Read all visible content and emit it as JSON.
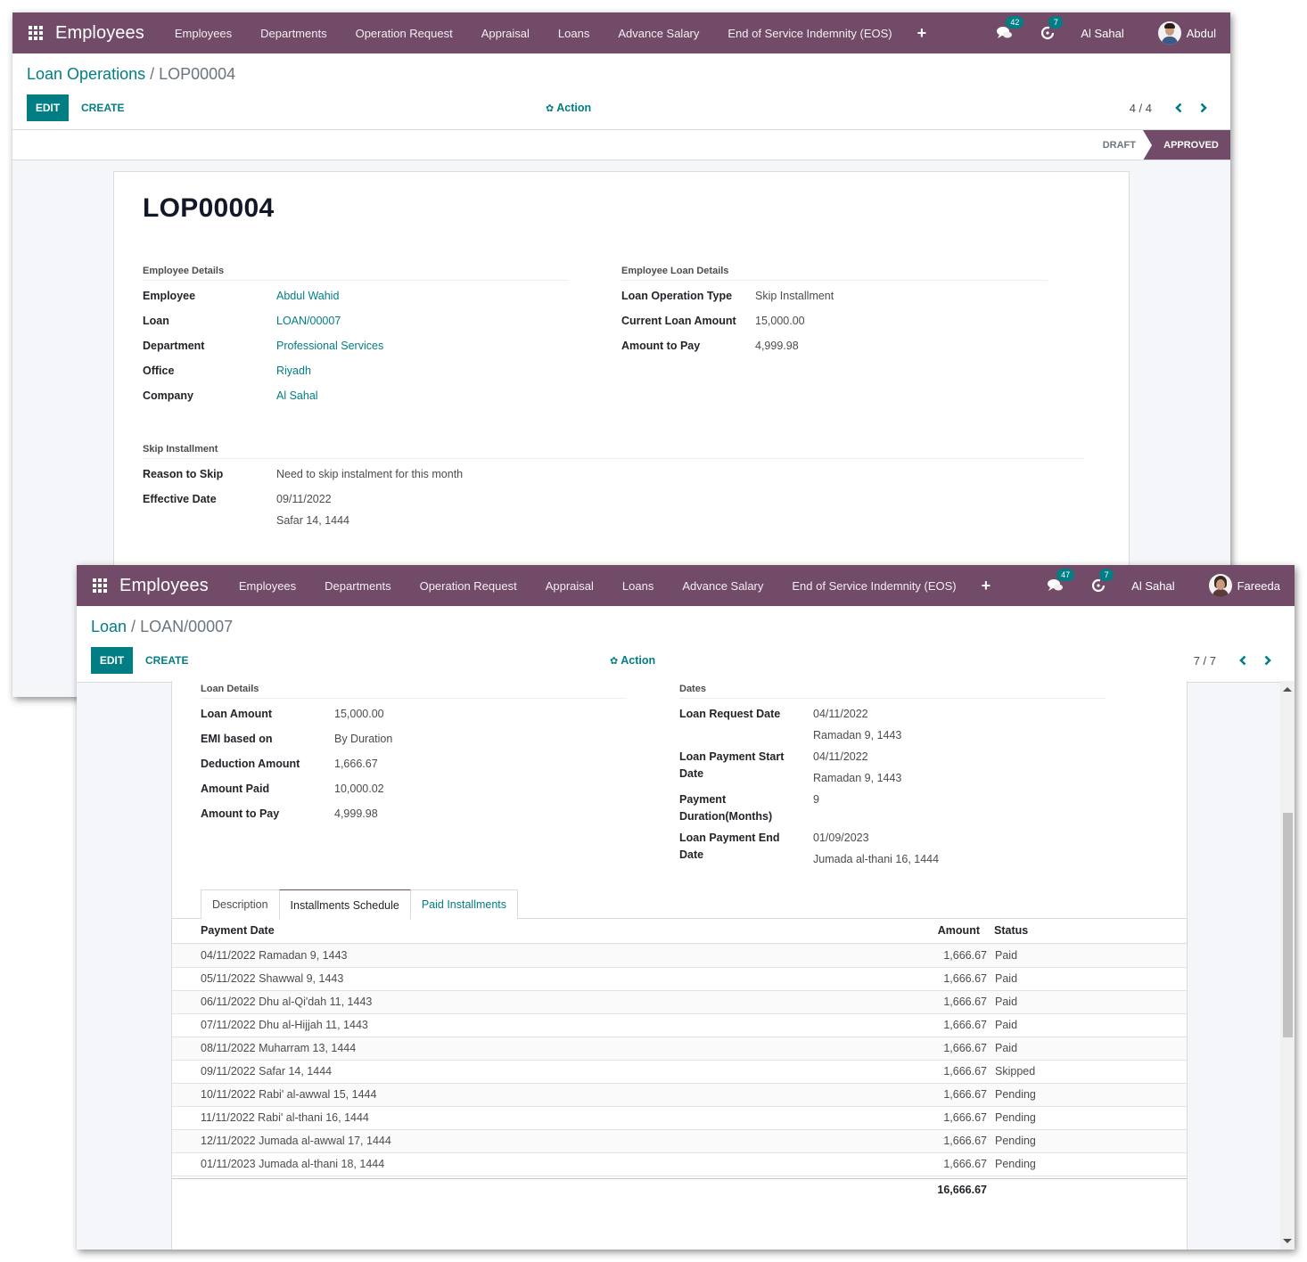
{
  "window1": {
    "navbar": {
      "brand": "Employees",
      "menu": [
        "Employees",
        "Departments",
        "Operation Request",
        "Appraisal",
        "Loans",
        "Advance Salary",
        "End of Service Indemnity (EOS)"
      ],
      "messages_count": "42",
      "activities_count": "7",
      "company": "Al Sahal",
      "user": "Abdul"
    },
    "breadcrumb": {
      "parent": "Loan Operations",
      "separator": " / ",
      "current": "LOP00004"
    },
    "buttons": {
      "edit": "EDIT",
      "create": "CREATE",
      "action": "Action"
    },
    "pager": {
      "text": "4 / 4"
    },
    "statusbar": {
      "stages": [
        "DRAFT",
        "APPROVED"
      ],
      "active": "APPROVED"
    },
    "record": {
      "title": "LOP00004",
      "employee_details": {
        "title": "Employee Details",
        "fields": [
          {
            "label": "Employee",
            "value": "Abdul Wahid"
          },
          {
            "label": "Loan",
            "value": "LOAN/00007"
          },
          {
            "label": "Department",
            "value": "Professional Services"
          },
          {
            "label": "Office",
            "value": "Riyadh"
          },
          {
            "label": "Company",
            "value": "Al Sahal"
          }
        ]
      },
      "loan_details": {
        "title": "Employee Loan Details",
        "fields": [
          {
            "label": "Loan Operation Type",
            "value": "Skip Installment"
          },
          {
            "label": "Current Loan Amount",
            "value": "15,000.00"
          },
          {
            "label": "Amount to Pay",
            "value": "4,999.98"
          }
        ]
      },
      "skip_installment": {
        "title": "Skip Installment",
        "reason_label": "Reason to Skip",
        "reason_value": "Need to skip instalment for this month",
        "date_label": "Effective Date",
        "date_value": "09/11/2022",
        "date_hijri": "Safar 14, 1444"
      }
    }
  },
  "window2": {
    "navbar": {
      "brand": "Employees",
      "menu": [
        "Employees",
        "Departments",
        "Operation Request",
        "Appraisal",
        "Loans",
        "Advance Salary",
        "End of Service Indemnity (EOS)"
      ],
      "messages_count": "47",
      "activities_count": "7",
      "company": "Al Sahal",
      "user": "Fareeda"
    },
    "breadcrumb": {
      "parent": "Loan",
      "separator": " / ",
      "current": "LOAN/00007"
    },
    "buttons": {
      "edit": "EDIT",
      "create": "CREATE",
      "action": "Action"
    },
    "pager": {
      "text": "7 / 7"
    },
    "record": {
      "loan_details": {
        "title": "Loan Details",
        "fields": [
          {
            "label": "Loan Amount",
            "value": "15,000.00"
          },
          {
            "label": "EMI based on",
            "value": "By Duration"
          },
          {
            "label": "Deduction Amount",
            "value": "1,666.67"
          },
          {
            "label": "Amount Paid",
            "value": "10,000.02"
          },
          {
            "label": "Amount to Pay",
            "value": "4,999.98"
          }
        ]
      },
      "dates": {
        "title": "Dates",
        "request_label": "Loan Request Date",
        "request_value": "04/11/2022",
        "request_hijri": "Ramadan 9, 1443",
        "start_label_1": "Loan Payment Start",
        "start_label_2": "Date",
        "start_value": "04/11/2022",
        "start_hijri": "Ramadan 9, 1443",
        "duration_label_1": "Payment",
        "duration_label_2": "Duration(Months)",
        "duration_value": "9",
        "end_label_1": "Loan Payment End",
        "end_label_2": "Date",
        "end_value": "01/09/2023",
        "end_hijri": "Jumada al-thani 16, 1444"
      },
      "tabs": [
        "Description",
        "Installments Schedule",
        "Paid Installments"
      ],
      "active_tab": "Installments Schedule",
      "table": {
        "headers": {
          "date": "Payment Date",
          "amount": "Amount",
          "status": "Status"
        },
        "rows": [
          {
            "date": "04/11/2022 Ramadan 9, 1443",
            "amount": "1,666.67",
            "status": "Paid"
          },
          {
            "date": "05/11/2022 Shawwal 9, 1443",
            "amount": "1,666.67",
            "status": "Paid"
          },
          {
            "date": "06/11/2022 Dhu al-Qi'dah 11, 1443",
            "amount": "1,666.67",
            "status": "Paid"
          },
          {
            "date": "07/11/2022 Dhu al-Hijjah 11, 1443",
            "amount": "1,666.67",
            "status": "Paid"
          },
          {
            "date": "08/11/2022 Muharram 13, 1444",
            "amount": "1,666.67",
            "status": "Paid"
          },
          {
            "date": "09/11/2022 Safar 14, 1444",
            "amount": "1,666.67",
            "status": "Skipped"
          },
          {
            "date": "10/11/2022 Rabi' al-awwal 15, 1444",
            "amount": "1,666.67",
            "status": "Pending"
          },
          {
            "date": "11/11/2022 Rabi' al-thani 16, 1444",
            "amount": "1,666.67",
            "status": "Pending"
          },
          {
            "date": "12/11/2022 Jumada al-awwal 17, 1444",
            "amount": "1,666.67",
            "status": "Pending"
          },
          {
            "date": "01/11/2023 Jumada al-thani 18, 1444",
            "amount": "1,666.67",
            "status": "Pending"
          }
        ],
        "total": "16,666.67"
      }
    }
  },
  "colors": {
    "brand": "#714b67",
    "accent": "#017e84"
  }
}
